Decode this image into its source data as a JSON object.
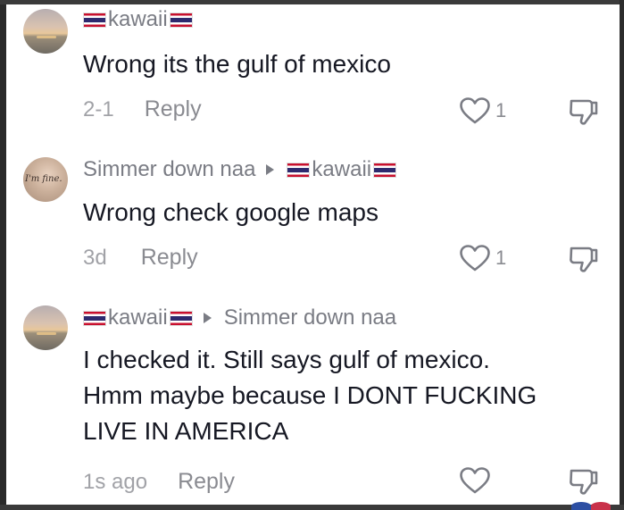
{
  "comments": [
    {
      "author": "kawaii",
      "reply_to": "",
      "text": "Wrong its the gulf of mexico",
      "time": "2-1",
      "reply_label": "Reply",
      "likes": "1"
    },
    {
      "author": "Simmer down naa",
      "reply_to": "kawaii",
      "avatar_text": "I'm fine.",
      "text": "Wrong check google maps",
      "time": "3d",
      "reply_label": "Reply",
      "likes": "1"
    },
    {
      "author": "kawaii",
      "reply_to": "Simmer down naa",
      "text_lines": [
        "I checked it. Still says gulf of mexico.",
        "Hmm maybe because I DONT FUCKING",
        "LIVE IN AMERICA"
      ],
      "time": "1s ago",
      "reply_label": "Reply",
      "likes": ""
    }
  ],
  "icons": {
    "like": "heart-outline-icon",
    "dislike": "thumbs-down-icon",
    "flag": "thailand-flag-icon",
    "reply_arrow": "play-triangle-icon"
  },
  "colors": {
    "text": "#161823",
    "secondary": "#7a7c84",
    "muted": "#a1a2a7"
  }
}
